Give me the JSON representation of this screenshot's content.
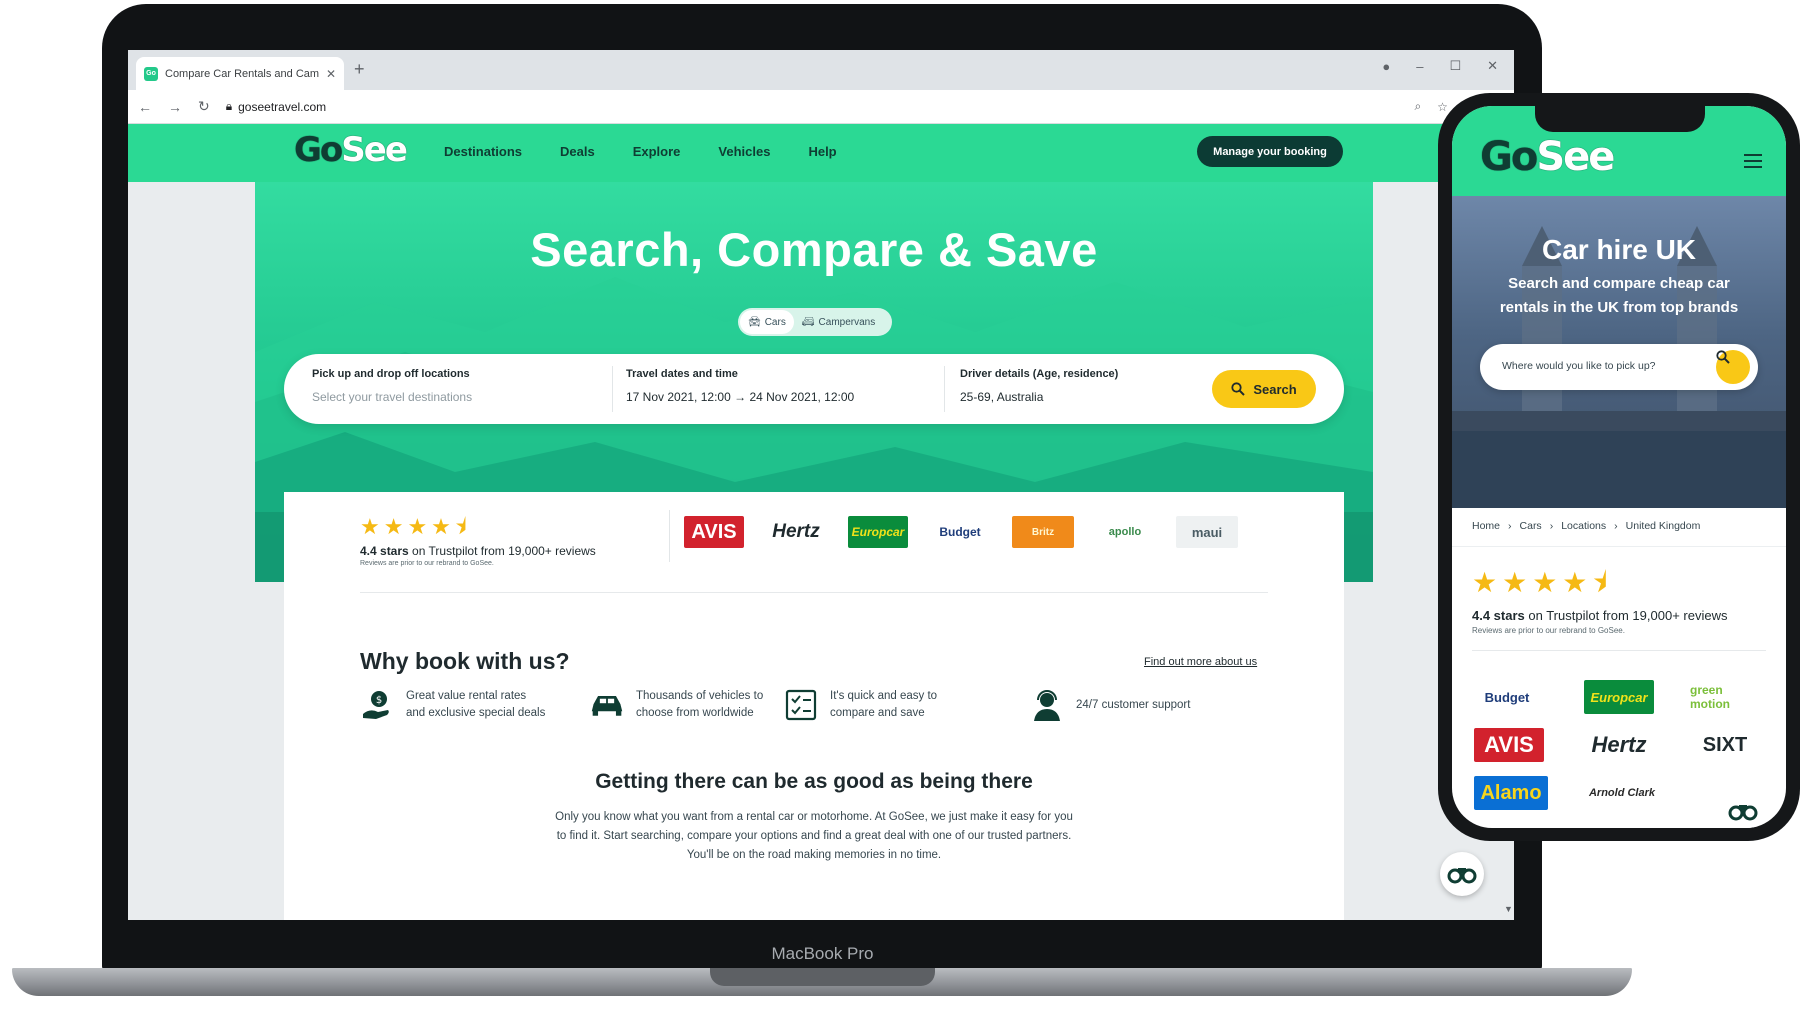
{
  "browser": {
    "tab_title": "Compare Car Rentals and Campe",
    "favicon_text": "Go",
    "url": "goseetravel.com",
    "new_tab": "+",
    "close_tab": "✕"
  },
  "nav": {
    "logo_go": "Go",
    "logo_see": "See",
    "links": [
      "Destinations",
      "Deals",
      "Explore",
      "Vehicles",
      "Help"
    ],
    "manage_booking": "Manage your booking"
  },
  "hero": {
    "title": "Search, Compare & Save",
    "modes": [
      "Cars",
      "Campervans"
    ],
    "active_mode": "Cars"
  },
  "search": {
    "locations_label": "Pick up and drop off locations",
    "locations_placeholder": "Select your travel destinations",
    "dates_label": "Travel dates and time",
    "date_from": "17 Nov 2021, 12:00",
    "date_to": "24 Nov 2021, 12:00",
    "driver_label": "Driver details (Age, residence)",
    "driver_value": "25-69, Australia",
    "button": "Search"
  },
  "rating": {
    "stars": "★★★★",
    "half_star": "⯨",
    "score": "4.4 stars",
    "text": "on Trustpilot from 19,000+ reviews",
    "note": "Reviews are prior to our rebrand to GoSee."
  },
  "brands": [
    "AVIS",
    "Hertz",
    "Europcar",
    "Budget",
    "Britz",
    "apollo",
    "maui"
  ],
  "why": {
    "title": "Why book with us?",
    "link": "Find out more about us",
    "features": [
      {
        "icon": "money-hand-icon",
        "line1": "Great value rental rates",
        "line2": "and exclusive special deals"
      },
      {
        "icon": "car-icon",
        "line1": "Thousands of vehicles to",
        "line2": "choose from worldwide"
      },
      {
        "icon": "checklist-icon",
        "line1": "It's quick and easy to",
        "line2": "compare and save"
      },
      {
        "icon": "support-agent-icon",
        "line1": "24/7 customer support",
        "line2": ""
      }
    ]
  },
  "getting": {
    "title": "Getting there can be as good as being there",
    "line1": "Only you know what you want from a rental car or motorhome. At GoSee, we just make it easy for you",
    "line2": "to find it. Start searching, compare your options and find a great deal with one of our trusted partners.",
    "line3": "You'll be on the road making memories in no time."
  },
  "device": {
    "laptop_label": "MacBook Pro"
  },
  "phone": {
    "title": "Car hire UK",
    "subtitle": "Search and compare cheap car rentals in the UK from top brands",
    "search_placeholder": "Where would you like to pick up?",
    "breadcrumb": [
      "Home",
      "Cars",
      "Locations",
      "United Kingdom"
    ],
    "rating_score": "4.4 stars",
    "rating_text": "on Trustpilot from 19,000+ reviews",
    "rating_note": "Reviews are prior to our rebrand to GoSee.",
    "brands": [
      "Budget",
      "Europcar",
      "green motion",
      "AVIS",
      "Hertz",
      "SIXT",
      "Alamo",
      "Arnold Clark"
    ]
  },
  "colors": {
    "brand_green": "#2bd994",
    "dark_teal": "#0c3b34",
    "search_yellow": "#f9c816",
    "star_gold": "#f5b914"
  }
}
